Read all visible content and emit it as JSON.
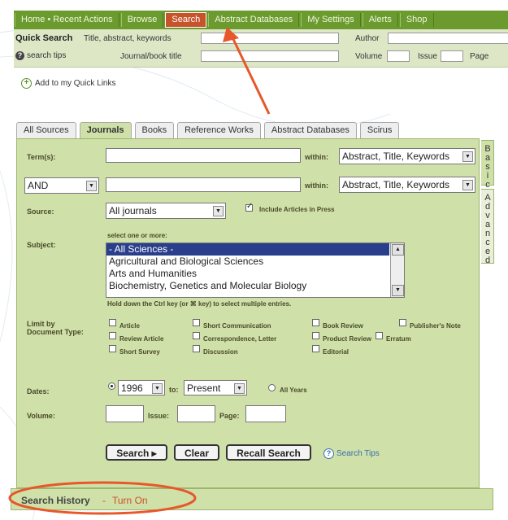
{
  "nav": {
    "items": [
      "Home • Recent Actions",
      "Browse",
      "Search",
      "Abstract Databases",
      "My Settings",
      "Alerts",
      "Shop"
    ],
    "active_index": 2
  },
  "quick_search": {
    "title": "Quick Search",
    "terms_label": "Title, abstract, keywords",
    "author_label": "Author",
    "tips_link": "search tips",
    "journal_label": "Journal/book title",
    "volume_label": "Volume",
    "issue_label": "Issue",
    "page_label": "Page"
  },
  "quick_links": "Add to my Quick Links",
  "tabs": [
    "All Sources",
    "Journals",
    "Books",
    "Reference Works",
    "Abstract Databases",
    "Scirus"
  ],
  "active_tab": 1,
  "side_tabs": [
    "Basic",
    "Advanced"
  ],
  "form": {
    "terms_label": "Term(s):",
    "within_label": "within:",
    "within_value_1": "Abstract, Title, Keywords",
    "within_value_2": "Abstract, Title, Keywords",
    "operator": "AND",
    "source_label": "Source:",
    "source_value": "All journals",
    "include_press": "Include Articles in Press",
    "subject_label": "Subject:",
    "select_hint": "select one or more:",
    "subjects": [
      "- All Sciences -",
      "Agricultural and Biological Sciences",
      "Arts and Humanities",
      "Biochemistry, Genetics and Molecular Biology"
    ],
    "ctrl_hint": "Hold down the Ctrl key (or ⌘ key) to select multiple entries.",
    "doc_type_label_1": "Limit by",
    "doc_type_label_2": "Document Type:",
    "doc_types": [
      "Article",
      "Short Communication",
      "Book Review",
      "Publisher's Note",
      "Review Article",
      "Correspondence, Letter",
      "Product Review",
      "Erratum",
      "Short Survey",
      "Discussion",
      "Editorial"
    ],
    "dates_label": "Dates:",
    "date_from": "1996",
    "to_label": "to:",
    "date_to": "Present",
    "all_years": "All Years",
    "volume_label": "Volume:",
    "issue_label": "Issue:",
    "page_label": "Page:",
    "search_btn": "Search ▸",
    "clear_btn": "Clear",
    "recall_btn": "Recall Search",
    "search_tips": "Search Tips"
  },
  "history": {
    "title": "Search History",
    "separator": "-",
    "turn_on": "Turn On"
  },
  "colors": {
    "nav_bg": "#6b9a2e",
    "panel_bg": "#cfe0a8",
    "annotation": "#e8572a",
    "link": "#3a6fb0"
  }
}
